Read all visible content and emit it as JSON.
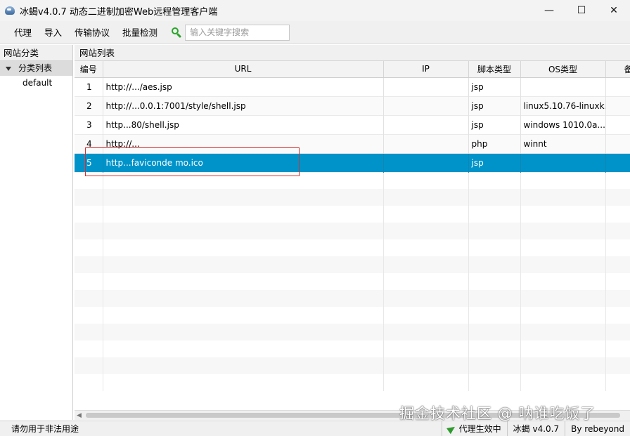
{
  "window": {
    "title": "冰蝎v4.0.7 动态二进制加密Web远程管理客户端",
    "minimize": "—",
    "maximize": "☐",
    "close": "✕"
  },
  "menu": {
    "items": [
      "代理",
      "导入",
      "传输协议",
      "批量检测"
    ],
    "search_placeholder": "输入关键字搜索"
  },
  "left": {
    "header": "网站分类",
    "tree_root": "分类列表",
    "tree_child": "default"
  },
  "right": {
    "header": "网站列表",
    "columns": [
      "编号",
      "URL",
      "IP",
      "脚本类型",
      "OS类型",
      "备"
    ],
    "rows": [
      {
        "num": "1",
        "url": "http://.../aes.jsp",
        "ip": "",
        "type": "jsp",
        "os": ""
      },
      {
        "num": "2",
        "url": "http://...0.0.1:7001/style/shell.jsp",
        "ip": "",
        "type": "jsp",
        "os": "linux5.10.76-linuxk..."
      },
      {
        "num": "3",
        "url": "http...80/shell.jsp",
        "ip": "",
        "type": "jsp",
        "os": "windows 1010.0a..."
      },
      {
        "num": "4",
        "url": "http://...",
        "ip": "",
        "type": "php",
        "os": "winnt"
      },
      {
        "num": "5",
        "url": "http...faviconde mo.ico",
        "ip": "",
        "type": "jsp",
        "os": ""
      }
    ]
  },
  "status": {
    "left": "请勿用于非法用途",
    "proxy": "代理生效中",
    "version": "冰蝎 v4.0.7",
    "author": "By rebeyond"
  },
  "watermark": "掘金技术社区 @ 呐谁吃饭了"
}
